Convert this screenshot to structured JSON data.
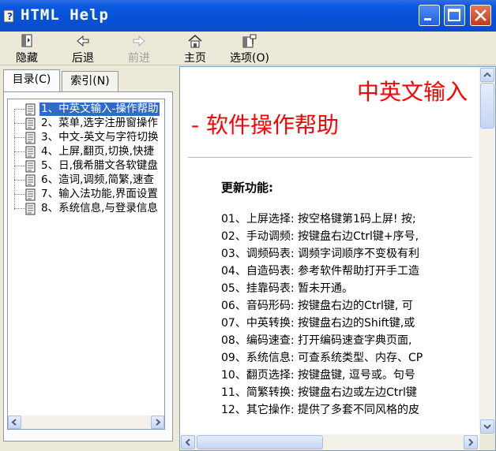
{
  "window": {
    "title": "HTML Help"
  },
  "toolbar": {
    "hide": "隐藏",
    "back": "后退",
    "forward": "前进",
    "home": "主页",
    "options": "选项(O)"
  },
  "tabs": {
    "contents": "目录(C)",
    "index": "索引(N)"
  },
  "tree": {
    "items": [
      "1、中英文输入-操作帮助",
      "2、菜单,选字注册窗操作",
      "3、中文-英文与字符切换",
      "4、上屏,翻页,切换,快捷",
      "5、日,俄希腊文各软键盘",
      "6、造词,调频,简繁,速查",
      "7、输入法功能,界面设置",
      "8、系统信息,与登录信息"
    ],
    "selected_index": 0
  },
  "content": {
    "heading_line1": "中英文输入",
    "heading_line2": "- 软件操作帮助",
    "subheading": "更新功能:",
    "features": [
      "01、上屏选择: 按空格键第1码上屏! 按;",
      "02、手动调频: 按键盘右边Ctrl键+序号,",
      "03、调频码表: 调频字词顺序不变极有利",
      "04、自造码表: 参考软件帮助打开手工造",
      "05、挂靠码表: 暂未开通。",
      "06、音码形码: 按键盘右边的Ctrl键, 可",
      "07、中英转换: 按键盘右边的Shift键,或",
      "08、编码速查: 打开编码速查字典页面,",
      "09、系统信息: 可查系统类型、内存、CP",
      "10、翻页选择: 按键盘键, 逗号或。句号",
      "11、简繁转换: 按键盘右边或左边Ctrl键",
      "12、其它操作: 提供了多套不同风格的皮"
    ]
  },
  "colors": {
    "title_bar": "#0A58E0",
    "heading": "#FF0000",
    "selection": "#316AC5"
  },
  "icons": [
    "help-icon",
    "minimize-icon",
    "maximize-icon",
    "close-icon",
    "hide-icon",
    "back-icon",
    "forward-icon",
    "home-icon",
    "options-icon",
    "document-icon"
  ]
}
